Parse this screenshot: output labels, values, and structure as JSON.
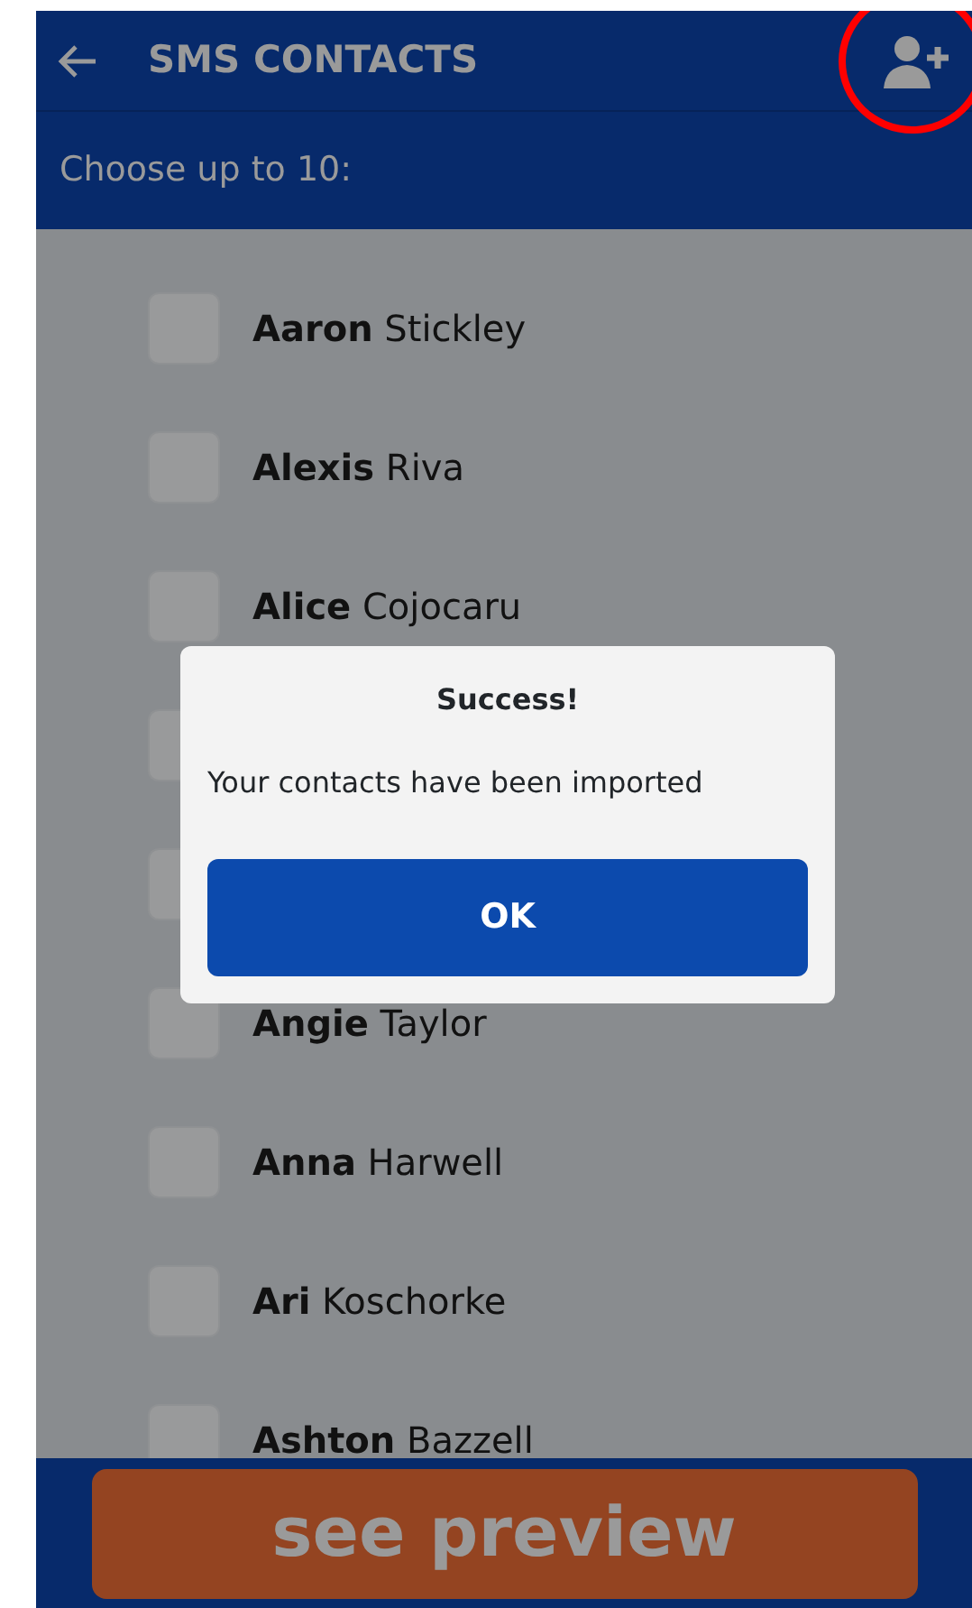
{
  "header": {
    "title": "SMS CONTACTS"
  },
  "subheader": "Choose up to 10:",
  "contacts": [
    {
      "kind": "contact",
      "first": "Aaron",
      "last": "Stickley",
      "checked": false
    },
    {
      "kind": "contact",
      "first": "Alexis",
      "last": "Riva",
      "checked": false
    },
    {
      "kind": "contact",
      "first": "Alice",
      "last": "Cojocaru",
      "checked": false
    },
    {
      "kind": "covered",
      "checked": false
    },
    {
      "kind": "covered",
      "checked": false
    },
    {
      "kind": "contact",
      "first": "Angie",
      "last": "Taylor",
      "checked": false
    },
    {
      "kind": "contact",
      "first": "Anna",
      "last": "Harwell",
      "checked": false
    },
    {
      "kind": "contact",
      "first": "Ari",
      "last": "Koschorke",
      "checked": false
    },
    {
      "kind": "contact",
      "first": "Ashton",
      "last": "Bazzell",
      "checked": false
    }
  ],
  "dialog": {
    "title": "Success!",
    "message": "Your contacts have been imported",
    "button": "OK"
  },
  "footer": {
    "button": "see preview"
  }
}
